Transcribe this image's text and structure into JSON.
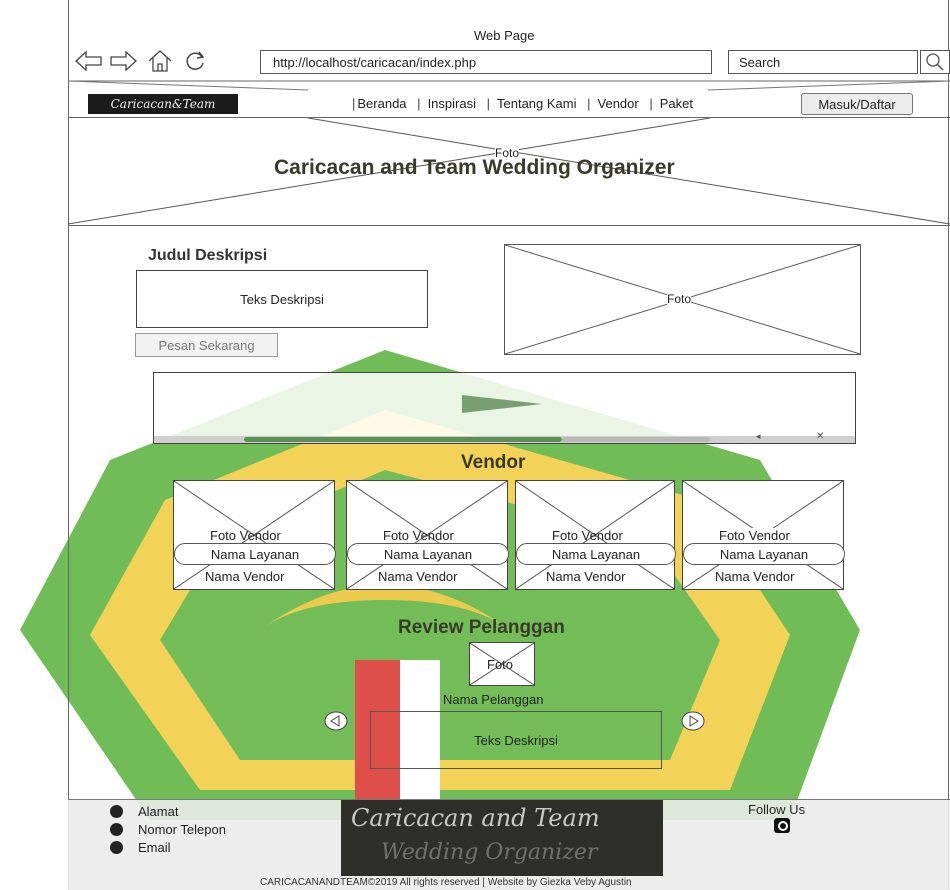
{
  "window": {
    "title": "Web Page"
  },
  "address_bar": {
    "url": "http://localhost/caricacan/index.php"
  },
  "search": {
    "placeholder": "Search"
  },
  "navbar": {
    "logo": "Caricacan&Team",
    "items": [
      "Beranda",
      "Inspirasi",
      "Tentang Kami",
      "Vendor",
      "Paket"
    ],
    "login_button": "Masuk/Daftar"
  },
  "hero": {
    "photo_label": "Foto",
    "title": "Caricacan and Team Wedding Organizer"
  },
  "description": {
    "heading": "Judul Deskripsi",
    "text": "Teks Deskripsi",
    "button": "Pesan Sekarang",
    "photo_label": "Foto"
  },
  "vendor_section": {
    "heading": "Vendor",
    "cards": [
      {
        "photo": "Foto Vendor",
        "service": "Nama Layanan",
        "vendor": "Nama Vendor"
      },
      {
        "photo": "Foto Vendor",
        "service": "Nama Layanan",
        "vendor": "Nama Vendor"
      },
      {
        "photo": "Foto Vendor",
        "service": "Nama Layanan",
        "vendor": "Nama Vendor"
      },
      {
        "photo": "Foto Vendor",
        "service": "Nama Layanan",
        "vendor": "Nama Vendor"
      }
    ]
  },
  "review_section": {
    "heading": "Review Pelanggan",
    "photo_label": "Foto",
    "customer_name": "Nama Pelanggan",
    "text": "Teks Deskripsi"
  },
  "footer": {
    "contacts": [
      "Alamat",
      "Nomor Telepon",
      "Email"
    ],
    "logo_line1": "Caricacan and Team",
    "logo_line2": "Wedding Organizer",
    "follow_us": "Follow Us",
    "copyright": "CARICACANANDTEAM©2019 All rights reserved | Website by Giezka Veby Agustin"
  },
  "colors": {
    "watermark_green": "#4caf2f",
    "watermark_yellow": "#f3d23a",
    "heading_dark": "#3a3a2a"
  }
}
